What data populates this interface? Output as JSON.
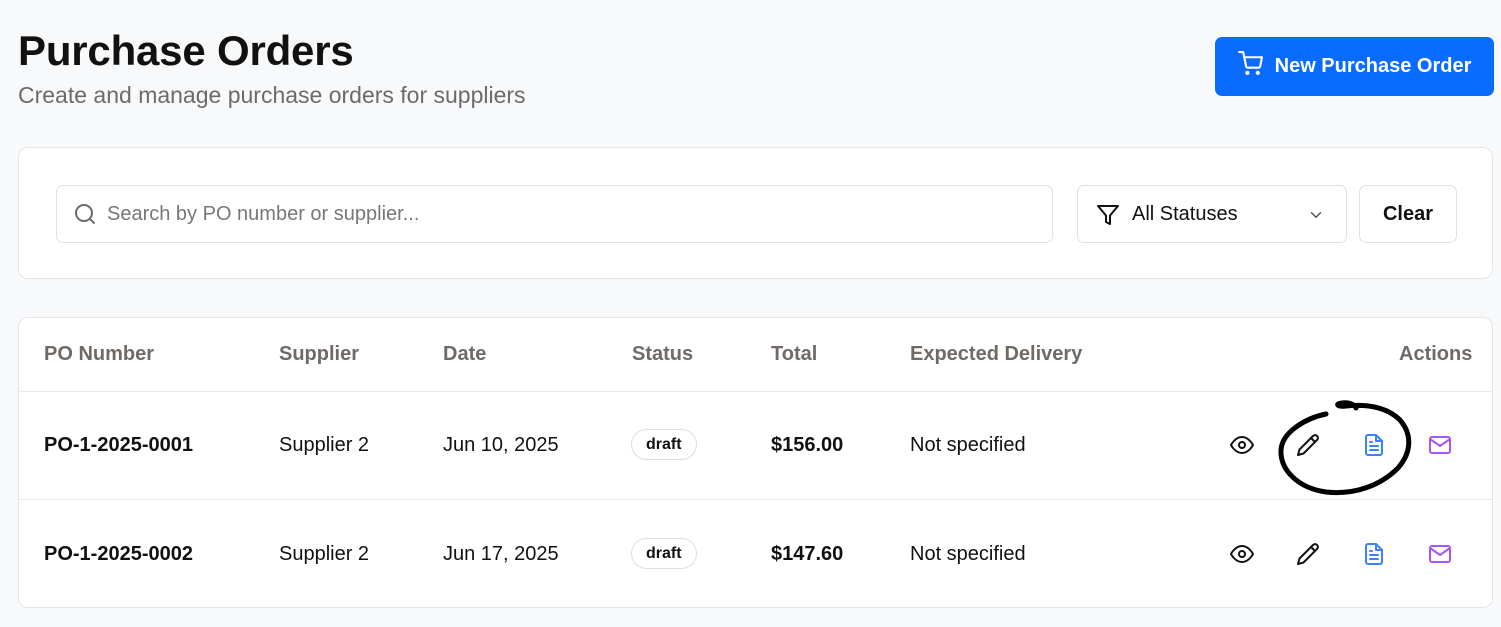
{
  "header": {
    "title": "Purchase Orders",
    "subtitle": "Create and manage purchase orders for suppliers",
    "new_button_label": "New Purchase Order"
  },
  "filters": {
    "search_placeholder": "Search by PO number or supplier...",
    "search_value": "",
    "status_selected": "All Statuses",
    "clear_label": "Clear"
  },
  "table": {
    "columns": [
      "PO Number",
      "Supplier",
      "Date",
      "Status",
      "Total",
      "Expected Delivery",
      "Actions"
    ],
    "rows": [
      {
        "po_number": "PO-1-2025-0001",
        "supplier": "Supplier 2",
        "date": "Jun 10, 2025",
        "status": "draft",
        "total": "$156.00",
        "expected_delivery": "Not specified"
      },
      {
        "po_number": "PO-1-2025-0002",
        "supplier": "Supplier 2",
        "date": "Jun 17, 2025",
        "status": "draft",
        "total": "$147.60",
        "expected_delivery": "Not specified"
      }
    ],
    "actions": [
      "eye-icon",
      "pencil-icon",
      "document-icon",
      "mail-icon"
    ]
  },
  "colors": {
    "accent": "#0a6cff",
    "document_icon": "#3b82f6",
    "mail_icon": "#a855f7",
    "annotation": "#000000"
  }
}
